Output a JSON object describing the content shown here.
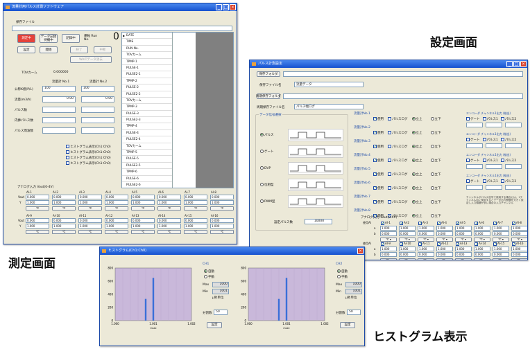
{
  "captions": {
    "settings": "設定画面",
    "measurement": "測定画面",
    "histogram": "ヒストグラム表示"
  },
  "measure_win": {
    "title": "流量計用パルス計測ソフトウェア",
    "save_file_label": "保存ファイル",
    "btn_measuring": "測定中",
    "btn_data_saving": "データ記録 待機中",
    "btn_saving": "記録中",
    "run_no_label": "運転 Run No.",
    "run_no_value": "0",
    "btn_settings": "設定",
    "btn_start": "開始",
    "btn_stop": "終了",
    "btn_abort": "中断",
    "btn_wait_clear": "WAITデータ消去",
    "tov_label": "TOVカーム",
    "tov_value": "0.000000",
    "meter1": "流量計 No.1",
    "meter2": "流量計 No.2",
    "rows": [
      {
        "label": "公称K値(P/L)",
        "v1": "100",
        "v2": "100"
      },
      {
        "label": "流量(m3/h)",
        "v1": "0.00",
        "v2": "0.00"
      },
      {
        "label": "パルス数",
        "v1": "",
        "v2": ""
      },
      {
        "label": "内挿パルス数",
        "v1": "",
        "v2": ""
      },
      {
        "label": "パルス周波数",
        "v1": "",
        "v2": ""
      }
    ],
    "hist_checks": [
      "ヒストグラム表示(Ch1:Ch0)",
      "ヒストグラム表示(Ch1:Ch0)",
      "ヒストグラム表示(Ch1:Ch0)",
      "ヒストグラム表示(Ch1:Ch0)"
    ],
    "list": [
      "DATE",
      "TIME",
      "RUN No.",
      "TOVカーム",
      "TPMP-1",
      "PULSE-1",
      "PULSE2-1",
      "TPMP-2",
      "PULSE-2",
      "PULSE2-2",
      "TOVカーム",
      "TPMP-3",
      "PULSE-3",
      "PULSE2-3",
      "TPMP-4",
      "PULSE-4",
      "PULSE2-4",
      "TOVカーム",
      "TPMP-5",
      "PULSE-5",
      "PULSE2-5",
      "TPMP-6",
      "PULSE-6",
      "PULSE2-6"
    ],
    "analog_label": "アナログ入力 Vout(0-4V)",
    "ai1": [
      "AI-1",
      "AI-2",
      "AI-3",
      "AI-4",
      "AI-5",
      "AI-6",
      "AI-7",
      "AI-8"
    ],
    "ai2": [
      "AI-9",
      "AI-10",
      "AI-11",
      "AI-12",
      "AI-13",
      "AI-14",
      "AI-15",
      "AI-16"
    ],
    "vout": "Vout",
    "y": "Y",
    "val_a": "0.000",
    "val_b": "1.000",
    "unit": "℃"
  },
  "settings_win": {
    "title": "パルス計測設定",
    "btn_save_folder": "保存フォルダ",
    "save_file_label": "保存ファイル名",
    "save_file_value": "流量データ",
    "btn_periodic": "周期保存フォルダ",
    "periodic_label": "周期保存ファイル名",
    "periodic_value": "パルス幅ログ",
    "data_type_label": "データ信号選択",
    "signal_options": [
      {
        "label": "パルス",
        "on": true
      },
      {
        "label": "ゲート",
        "on": false
      },
      {
        "label": "DVP",
        "on": false
      },
      {
        "label": "位相型",
        "on": false
      },
      {
        "label": "PWM型",
        "on": false
      }
    ],
    "set_pulse_label": "設定パルス数",
    "set_pulse_value": "10000",
    "meters": [
      "流量計No.1",
      "流量計No.2",
      "流量計No.3",
      "流量計No.4",
      "流量計No.5",
      "流量計No.6",
      "流量計No.7",
      "流量計No.8"
    ],
    "use": "使用",
    "pulse_log": "パルスログ",
    "rise": "立上",
    "fall": "立下",
    "encoder_label": "エンコーダ チャンネル1出力 (検出)",
    "enc_opts": [
      "ゲート",
      "パルス1",
      "パルス2"
    ],
    "note": "チャンネルがパルス信号で使用する場合には、1チャンネル目に使用するとデータ出力間隔を大きく設定し入力頻度が多い場合の入力チャンネル",
    "analog_label": "アナログ入力 Vout(0-4V)",
    "use_label": "使用AI",
    "ai1": [
      "AI-1",
      "AI-2",
      "AI-3",
      "AI-4",
      "AI-5",
      "AI-6",
      "AI-7",
      "AI-8"
    ],
    "ai2": [
      "AI-9",
      "AI-10",
      "AI-11",
      "AI-12",
      "AI-13",
      "AI-14",
      "AI-15",
      "AI-16"
    ],
    "a_label": "a",
    "b_label": "b",
    "val_a": "1.000",
    "val_b": "0.000",
    "unit": "℃"
  },
  "hist_win": {
    "title": "ヒストグラム(Ch1:Ch0)",
    "panels": [
      {
        "ch": "CH1",
        "auto": "自動",
        "manual": "手動",
        "max_label": "Max",
        "max": "1000",
        "min_label": "Min",
        "min": "1001",
        "unit": "μ秒単位",
        "div_label": "分割数",
        "div": "50",
        "btn": "設定"
      },
      {
        "ch": "CH2",
        "auto": "自動",
        "manual": "手動",
        "max_label": "Max",
        "max": "1000",
        "min_label": "Min",
        "min": "1001",
        "unit": "μ秒単位",
        "div_label": "分割数",
        "div": "50",
        "btn": "設定"
      }
    ]
  },
  "chart_data": [
    {
      "type": "bar",
      "x": [
        1.0,
        1.001,
        1.002
      ],
      "values": [
        0,
        35,
        65,
        0
      ],
      "ylim": [
        0,
        800
      ],
      "xlabel": "msec",
      "ticks_y": [
        "800",
        "600",
        "400",
        "200",
        "0"
      ],
      "ticks_x": [
        "1.000",
        "1.001",
        "1.002"
      ],
      "bar_x": [
        1.0008,
        1.001
      ],
      "bar_h": [
        330,
        650
      ]
    },
    {
      "type": "bar",
      "x": [
        1.0,
        1.001,
        1.002
      ],
      "values": [
        0,
        35,
        65,
        0
      ],
      "ylim": [
        0,
        800
      ],
      "xlabel": "msec",
      "ticks_y": [
        "800",
        "600",
        "400",
        "200",
        "0"
      ],
      "ticks_x": [
        "1.000",
        "1.001",
        "1.002"
      ],
      "bar_x": [
        1.0008,
        1.001
      ],
      "bar_h": [
        330,
        650
      ]
    }
  ],
  "colors": {
    "title_bar": "#1652cf",
    "window_bg": "#ece9d8",
    "plot_bg": "#c9b8da",
    "bar": "#3a6fd8",
    "btn_red": "#e5423a"
  }
}
